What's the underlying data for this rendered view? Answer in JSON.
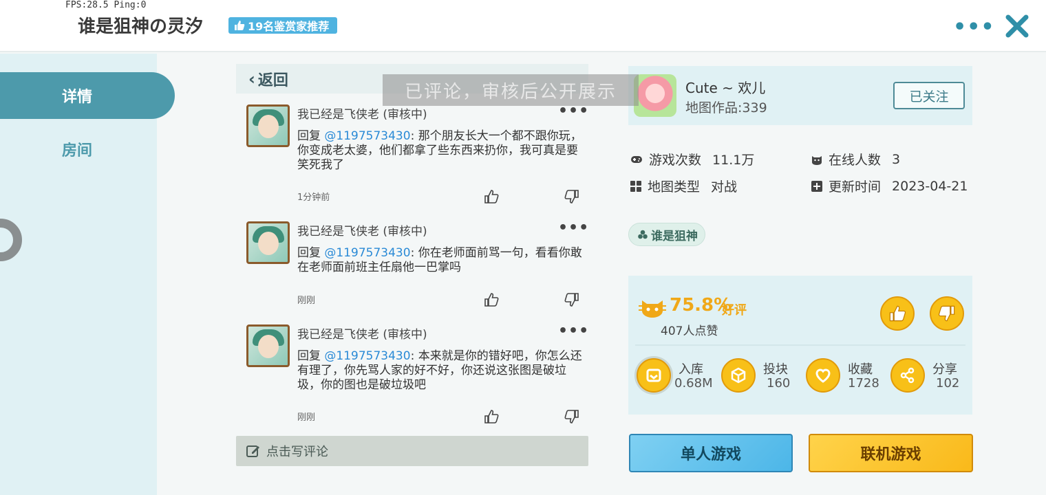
{
  "overlay": {
    "fps": "FPS:28.5  Ping:0"
  },
  "header": {
    "title": "谁是狙神の灵汐",
    "badge": "19名鉴赏家推荐",
    "more_icon": "more-dots-icon",
    "close_icon": "close-icon"
  },
  "sidebar": {
    "items": [
      {
        "label": "详情",
        "active": true
      },
      {
        "label": "房间",
        "active": false
      }
    ]
  },
  "comments_panel": {
    "back_label": "返回",
    "toast": "已评论，审核后公开展示",
    "comments": [
      {
        "name": "我已经是飞侠老 (审核中)",
        "prefix": "回复 ",
        "mention": "@1197573430",
        "text": ": 那个朋友长大一个都不跟你玩，你变成老太婆，他们都拿了些东西来扔你，我可真是要笑死我了",
        "time": "1分钟前"
      },
      {
        "name": "我已经是飞侠老 (审核中)",
        "prefix": "回复 ",
        "mention": "@1197573430",
        "text": ": 你在老师面前骂一句，看看你敢在老师面前班主任扇他一巴掌吗",
        "time": "刚刚"
      },
      {
        "name": "我已经是飞侠老 (审核中)",
        "prefix": "回复 ",
        "mention": "@1197573430",
        "text": ": 本来就是你的错好吧，你怎么还有理了，你先骂人家的好不好，你还说这张图是破垃圾，你的图也是破垃圾吧",
        "time": "刚刚"
      }
    ],
    "write_label": "点击写评论"
  },
  "author": {
    "name": "Cute ~ 欢儿",
    "works": "地图作品:339",
    "follow_label": "已关注"
  },
  "stats": {
    "plays_label": "游戏次数",
    "plays_value": "11.1万",
    "online_label": "在线人数",
    "online_value": "3",
    "type_label": "地图类型",
    "type_value": "对战",
    "updated_label": "更新时间",
    "updated_value": "2023-04-21"
  },
  "tag": "谁是狙神",
  "rating": {
    "percent": "75.8%",
    "good_label": "好评",
    "likes": "407人点赞"
  },
  "actions": [
    {
      "label": "入库",
      "value": "0.68M",
      "icon": "inbox-icon"
    },
    {
      "label": "投块",
      "value": "160",
      "icon": "block-icon"
    },
    {
      "label": "收藏",
      "value": "1728",
      "icon": "heart-icon"
    },
    {
      "label": "分享",
      "value": "102",
      "icon": "share-icon"
    }
  ],
  "buttons": {
    "solo": "单人游戏",
    "multi": "联机游戏"
  },
  "colors": {
    "accent": "#4d9aab",
    "mention": "#2a8ad6",
    "rating": "#f0a818",
    "solo_button": "#4cb6e8",
    "multi_button": "#f9b91a"
  }
}
